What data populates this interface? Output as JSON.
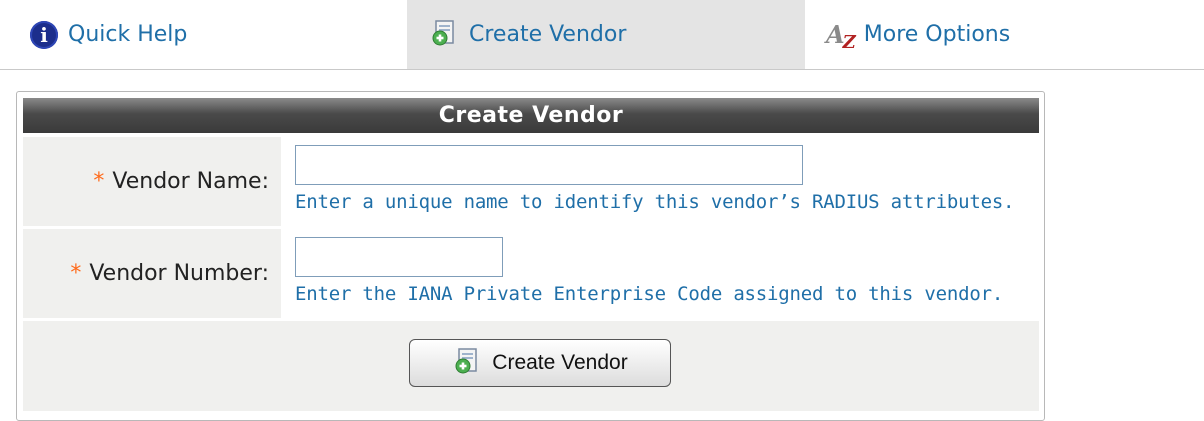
{
  "tabs": {
    "quick_help": "Quick Help",
    "create_vendor": "Create Vendor",
    "more_options": "More Options"
  },
  "panel": {
    "title": "Create Vendor",
    "vendor_name": {
      "label": "Vendor Name:",
      "value": "",
      "hint": "Enter a unique name to identify this vendor’s RADIUS attributes."
    },
    "vendor_number": {
      "label": "Vendor Number:",
      "value": "",
      "hint": "Enter the IANA Private Enterprise Code assigned to this vendor."
    },
    "submit_label": "Create Vendor"
  },
  "required_marker": "*",
  "icons": {
    "help": "info-icon",
    "create": "add-document-icon",
    "more": "az-sort-icon"
  },
  "colors": {
    "link": "#1f6fa8",
    "required": "#ff6a1a",
    "header_dark": "#3a3a3a",
    "active_tab": "#e4e4e4"
  }
}
